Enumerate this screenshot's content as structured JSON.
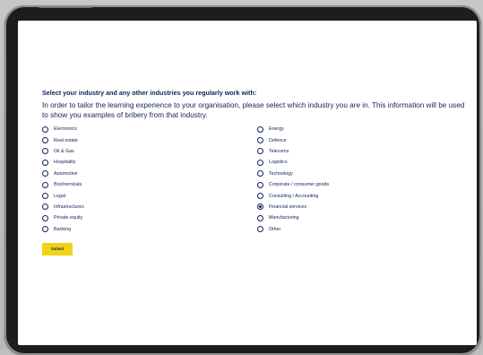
{
  "form": {
    "title": "Select your industry and any other industries you regularly work with:",
    "intro": "In order to tailor the learning experience to your organisation, please select which industry you are in. This information will be used to show you examples of bribery from that industry.",
    "left_options": [
      {
        "label": "Electronics",
        "checked": false
      },
      {
        "label": "Real estate",
        "checked": false
      },
      {
        "label": "Oil & Gas",
        "checked": false
      },
      {
        "label": "Hospitality",
        "checked": false
      },
      {
        "label": "Automotive",
        "checked": false
      },
      {
        "label": "Biochemicals",
        "checked": false
      },
      {
        "label": "Legal",
        "checked": false
      },
      {
        "label": "Infrastructures",
        "checked": false
      },
      {
        "label": "Private equity",
        "checked": false
      },
      {
        "label": "Banking",
        "checked": false
      }
    ],
    "right_options": [
      {
        "label": "Energy",
        "checked": false
      },
      {
        "label": "Defence",
        "checked": false
      },
      {
        "label": "Telecoms",
        "checked": false
      },
      {
        "label": "Logistics",
        "checked": false
      },
      {
        "label": "Technology",
        "checked": false
      },
      {
        "label": "Corporate / consumer goods",
        "checked": false
      },
      {
        "label": "Consulting / Accounting",
        "checked": false
      },
      {
        "label": "Financial services",
        "checked": true
      },
      {
        "label": "Manufacturing",
        "checked": false
      },
      {
        "label": "Other",
        "checked": false
      }
    ],
    "submit_label": "Submit"
  },
  "colors": {
    "text": "#12215c",
    "accent": "#f2d313",
    "background": "#ffffff"
  }
}
